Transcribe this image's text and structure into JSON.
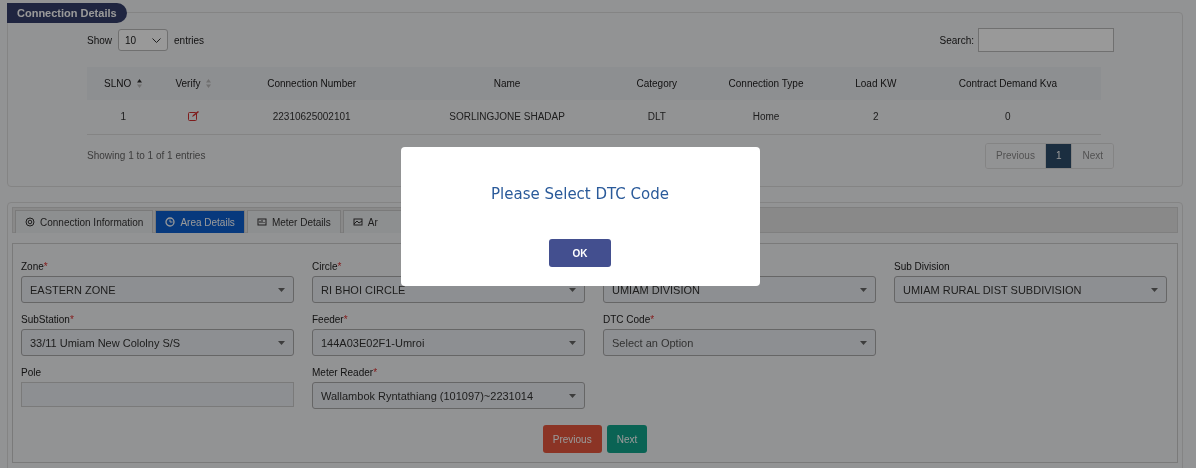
{
  "section_badge": "Connection Details",
  "table_controls": {
    "show_label": "Show",
    "page_size": "10",
    "entries_label": "entries",
    "search_label": "Search:"
  },
  "table": {
    "columns": [
      {
        "label": "SLNO",
        "sorted": true
      },
      {
        "label": "Verify",
        "sorted": false
      },
      {
        "label": "Connection Number"
      },
      {
        "label": "Name"
      },
      {
        "label": "Category"
      },
      {
        "label": "Connection Type"
      },
      {
        "label": "Load KW"
      },
      {
        "label": "Contract Demand Kva"
      }
    ],
    "rows": [
      {
        "cells": [
          {
            "kind": "text",
            "text": "1"
          },
          {
            "kind": "edit"
          },
          {
            "kind": "text",
            "text": "22310625002101"
          },
          {
            "kind": "text",
            "text": "SORLINGJONE SHADAP"
          },
          {
            "kind": "text",
            "text": "DLT"
          },
          {
            "kind": "text",
            "text": "Home"
          },
          {
            "kind": "text",
            "text": "2"
          },
          {
            "kind": "text",
            "text": "0"
          }
        ]
      }
    ]
  },
  "table_info": "Showing 1 to 1 of 1 entries",
  "pagination": [
    {
      "label": "Previous",
      "selected": false
    },
    {
      "label": "1",
      "selected": true
    },
    {
      "label": "Next",
      "selected": false
    }
  ],
  "tabs": [
    {
      "label": "Connection Information",
      "selected": false
    },
    {
      "label": "Area Details",
      "selected": true
    },
    {
      "label": "Meter Details",
      "selected": false
    },
    {
      "label": "Ar",
      "selected": false
    }
  ],
  "form_rows": [
    [
      {
        "label": "Zone",
        "required_mark": "*",
        "kind": "select",
        "value": "EASTERN ZONE"
      },
      {
        "label": "Circle",
        "required_mark": "*",
        "kind": "select",
        "value": "RI BHOI CIRCLE"
      },
      {
        "kind": "select",
        "value": "UMIAM DIVISION"
      },
      {
        "label": "Sub Division",
        "kind": "select",
        "value": "UMIAM RURAL DIST SUBDIVISION"
      }
    ],
    [
      {
        "label": "SubStation",
        "required_mark": "*",
        "kind": "select",
        "value": "33/11 Umiam New Cololny S/S"
      },
      {
        "label": "Feeder",
        "required_mark": "*",
        "kind": "select",
        "value": "144A03E02F1-Umroi"
      },
      {
        "label": "DTC Code",
        "required_mark": "*",
        "kind": "select",
        "placeholder": "Select an Option"
      }
    ],
    [
      {
        "label": "Pole",
        "kind": "text"
      },
      {
        "label": "Meter Reader",
        "required_mark": "*",
        "kind": "select",
        "value": "Wallambok Ryntathiang (101097)~2231014"
      }
    ]
  ],
  "form_buttons": [
    {
      "label": "Previous",
      "kind": "back"
    },
    {
      "label": "Next",
      "kind": "forward"
    }
  ],
  "dialog": {
    "message": "Please Select DTC Code",
    "button": "OK"
  }
}
